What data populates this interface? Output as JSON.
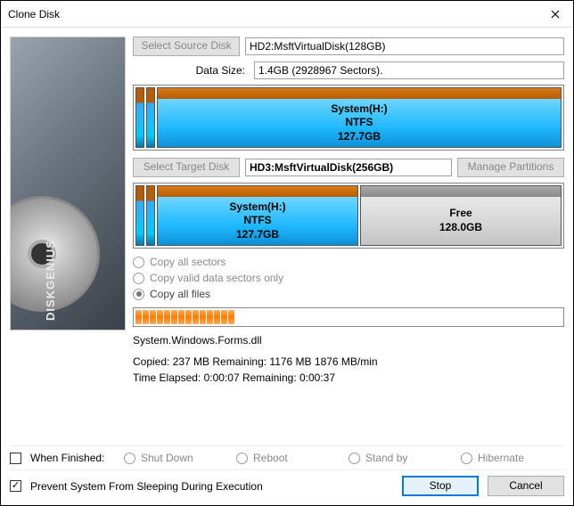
{
  "window": {
    "title": "Clone Disk"
  },
  "brand": "DISKGENIUS",
  "source": {
    "btn": "Select Source Disk",
    "value": "HD2:MsftVirtualDisk(128GB)",
    "datasize_label": "Data Size:",
    "datasize": "1.4GB (2928967 Sectors).",
    "part": {
      "name": "System(H:)",
      "fs": "NTFS",
      "size": "127.7GB"
    }
  },
  "target": {
    "btn": "Select Target Disk",
    "value": "HD3:MsftVirtualDisk(256GB)",
    "manage": "Manage Partitions",
    "part1": {
      "name": "System(H:)",
      "fs": "NTFS",
      "size": "127.7GB"
    },
    "part2": {
      "name": "Free",
      "size": "128.0GB"
    }
  },
  "copy_modes": {
    "all_sectors": "Copy all sectors",
    "valid_sectors": "Copy valid data sectors only",
    "all_files": "Copy all files"
  },
  "current_file": "System.Windows.Forms.dll",
  "stats": {
    "line1": "Copied:   237 MB   Remaining:   1176 MB   1876 MB/min",
    "line2": "Time Elapsed:  0:00:07  Remaining:  0:00:37"
  },
  "finished": {
    "label": "When Finished:",
    "shutdown": "Shut Down",
    "reboot": "Reboot",
    "standby": "Stand by",
    "hibernate": "Hibernate"
  },
  "prevent_sleep": "Prevent System From Sleeping During Execution",
  "actions": {
    "stop": "Stop",
    "cancel": "Cancel"
  }
}
